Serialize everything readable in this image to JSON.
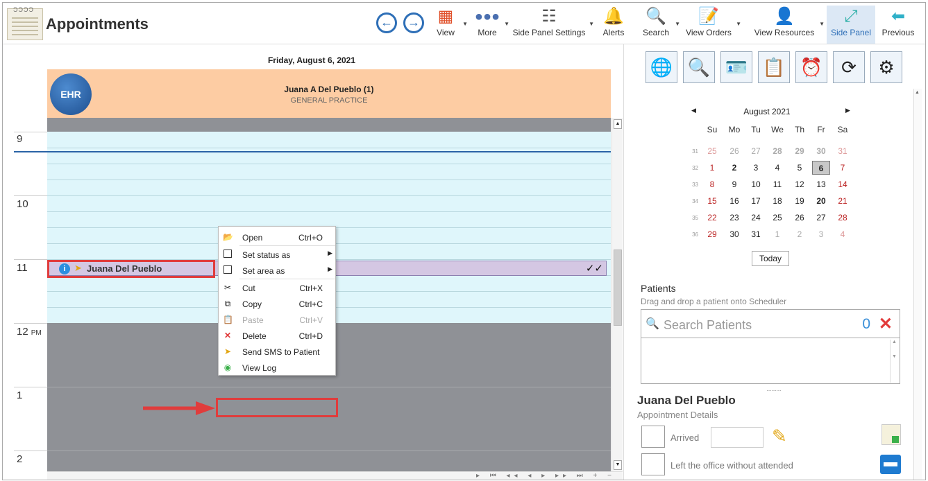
{
  "app": {
    "title": "Appointments"
  },
  "toolbar": {
    "view": "View",
    "more": "More",
    "side_panel_settings": "Side Panel Settings",
    "alerts": "Alerts",
    "search": "Search",
    "view_orders": "View Orders",
    "view_resources": "View Resources",
    "side_panel": "Side Panel",
    "previous": "Previous"
  },
  "scheduler": {
    "date": "Friday, August 6, 2021",
    "resource_name": "Juana A Del Pueblo (1)",
    "resource_specialty": "GENERAL PRACTICE",
    "logo_text": "EHR",
    "hours": [
      "9",
      "10",
      "11",
      "12",
      "1",
      "2"
    ],
    "pm_label": "PM",
    "appointment_name": "Juana Del Pueblo",
    "appointment_checks": "✓✓"
  },
  "context_menu": {
    "open": "Open",
    "open_sc": "Ctrl+O",
    "set_status": "Set status as",
    "set_area": "Set area as",
    "cut": "Cut",
    "cut_sc": "Ctrl+X",
    "copy": "Copy",
    "copy_sc": "Ctrl+C",
    "paste": "Paste",
    "paste_sc": "Ctrl+V",
    "delete": "Delete",
    "delete_sc": "Ctrl+D",
    "send_sms": "Send SMS to Patient",
    "view_log": "View Log"
  },
  "calendar": {
    "month": "August 2021",
    "dow": [
      "Su",
      "Mo",
      "Tu",
      "We",
      "Th",
      "Fr",
      "Sa"
    ],
    "weeks": [
      {
        "wk": "31",
        "days": [
          "25",
          "26",
          "27",
          "28",
          "29",
          "30",
          "31"
        ],
        "muted": [
          1,
          1,
          1,
          1,
          1,
          1,
          1
        ]
      },
      {
        "wk": "32",
        "days": [
          "1",
          "2",
          "3",
          "4",
          "5",
          "6",
          "7"
        ],
        "muted": [
          0,
          0,
          0,
          0,
          0,
          0,
          0
        ]
      },
      {
        "wk": "33",
        "days": [
          "8",
          "9",
          "10",
          "11",
          "12",
          "13",
          "14"
        ],
        "muted": [
          0,
          0,
          0,
          0,
          0,
          0,
          0
        ]
      },
      {
        "wk": "34",
        "days": [
          "15",
          "16",
          "17",
          "18",
          "19",
          "20",
          "21"
        ],
        "muted": [
          0,
          0,
          0,
          0,
          0,
          0,
          0
        ]
      },
      {
        "wk": "35",
        "days": [
          "22",
          "23",
          "24",
          "25",
          "26",
          "27",
          "28"
        ],
        "muted": [
          0,
          0,
          0,
          0,
          0,
          0,
          0
        ]
      },
      {
        "wk": "36",
        "days": [
          "29",
          "30",
          "31",
          "1",
          "2",
          "3",
          "4"
        ],
        "muted": [
          0,
          0,
          0,
          1,
          1,
          1,
          1
        ]
      }
    ],
    "selected": "6",
    "today_label": "Today"
  },
  "patients": {
    "title": "Patients",
    "hint": "Drag and drop a patient onto Scheduler",
    "placeholder": "Search Patients",
    "count": "0"
  },
  "details": {
    "patient_name": "Juana Del Pueblo",
    "subtitle": "Appointment Details",
    "arrived": "Arrived",
    "left_office": "Left the office without attended"
  },
  "colors": {
    "accent": "#2e6fb7",
    "highlight": "#e03c3c",
    "resource_header": "#fdcca3"
  }
}
